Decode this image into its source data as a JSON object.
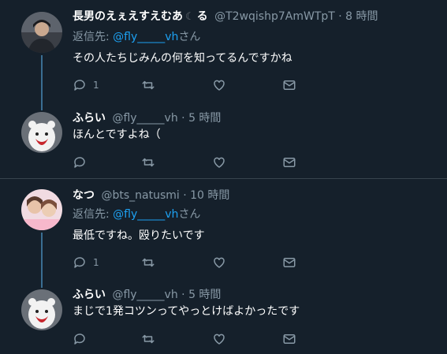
{
  "tweets": [
    {
      "name": "長男のえぇえすえむあ",
      "name_suffix": "る",
      "handle": "@T2wqishp7AmWTpT",
      "time": "· 8 時間",
      "reply_prefix": "返信先: ",
      "reply_mention": "@fly_____vh",
      "reply_suffix": "さん",
      "text": "その人たちじみんの何を知ってるんですかね",
      "reply_count": "1",
      "retweet_count": "",
      "like_count": "",
      "avatar_color": "#4a4f57"
    },
    {
      "name": "ふらい",
      "handle": "@fly_____vh",
      "time": "· 5 時間",
      "text": "ほんとですよね（",
      "reply_count": "",
      "retweet_count": "",
      "like_count": "",
      "avatar_color": "#5a6068"
    },
    {
      "name": "なつ",
      "handle": "@bts_natusmi",
      "time": "· 10 時間",
      "reply_prefix": "返信先: ",
      "reply_mention": "@fly_____vh",
      "reply_suffix": "さん",
      "text": "最低ですね。殴りたいです",
      "reply_count": "1",
      "retweet_count": "",
      "like_count": "",
      "avatar_color": "#e8c9d3"
    },
    {
      "name": "ふらい",
      "handle": "@fly_____vh",
      "time": "· 5 時間",
      "text": "まじで1発コツンってやっとけばよかったです",
      "reply_count": "",
      "retweet_count": "",
      "like_count": "",
      "avatar_color": "#5a6068"
    }
  ],
  "colors": {
    "background": "#15202b",
    "secondary_text": "#8899a6",
    "link": "#1da1f2",
    "divider": "#38444d",
    "thread_line": "#3a6e92"
  },
  "icons": [
    "reply-icon",
    "retweet-icon",
    "like-icon",
    "dm-icon"
  ]
}
